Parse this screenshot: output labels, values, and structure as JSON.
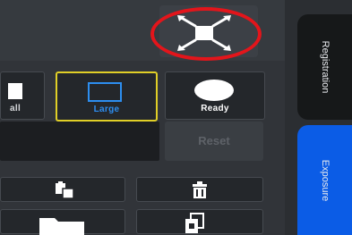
{
  "modes": [
    {
      "id": "small",
      "label": "all"
    },
    {
      "id": "large",
      "label": "Large"
    },
    {
      "id": "ready",
      "label": "Ready"
    }
  ],
  "actions": {
    "reset_label": "Reset"
  },
  "tools": {
    "paste": "paste-icon",
    "delete": "trash-icon",
    "folder": "folder-icon",
    "copy": "copy-icon"
  },
  "side_tabs": {
    "registration": "Registration",
    "exposure": "Exposure"
  },
  "colors": {
    "accent_blue": "#0b5ce6",
    "selection_yellow": "#e0cf27",
    "highlight_red": "#e3151b",
    "icon_blue": "#2d8ef0"
  }
}
